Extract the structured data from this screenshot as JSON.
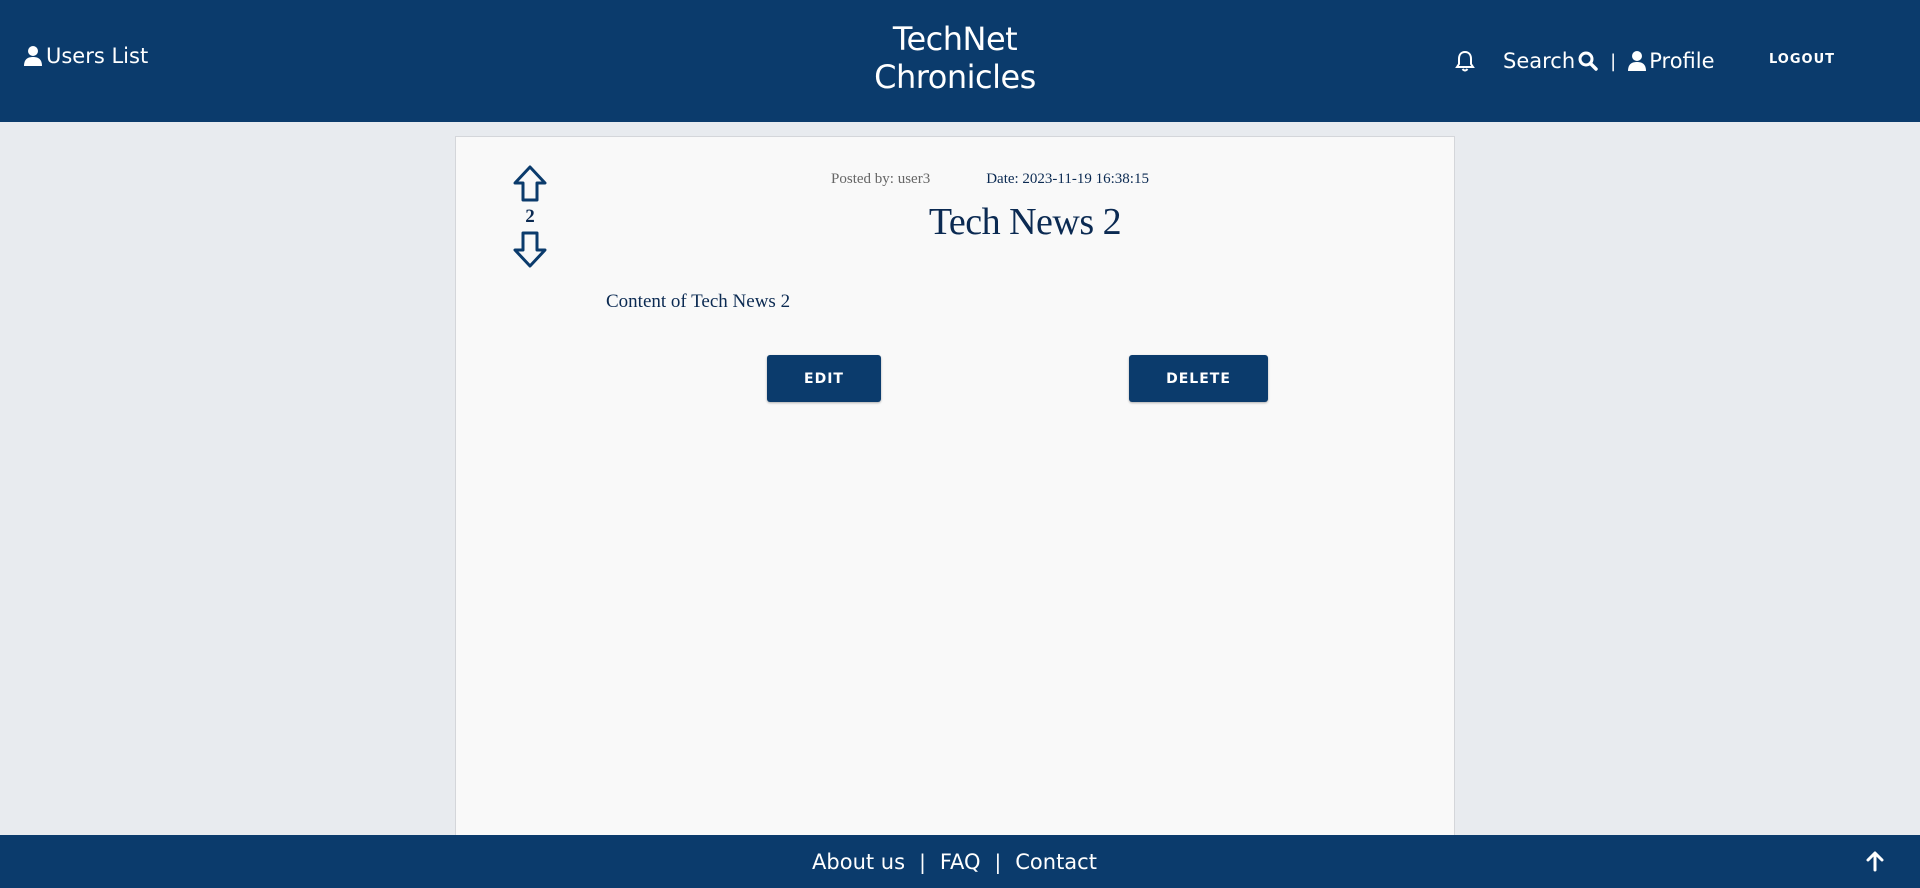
{
  "header": {
    "users_list_label": "Users List",
    "brand_line1": "TechNet",
    "brand_line2": "Chronicles",
    "search_label": "Search",
    "separator": "|",
    "profile_label": "Profile",
    "logout_label": "LOGOUT"
  },
  "post": {
    "votes": "2",
    "posted_by": "Posted by: user3",
    "date": "Date: 2023-11-19 16:38:15",
    "title": "Tech News 2",
    "content": "Content of Tech News 2",
    "edit_label": "EDIT",
    "delete_label": "DELETE"
  },
  "footer": {
    "links": [
      "About us",
      "FAQ",
      "Contact"
    ],
    "separator": "|"
  },
  "colors": {
    "primary": "#0b3b6c",
    "background": "#e8ebef",
    "card": "#f9f9f9",
    "text_dark": "#0b2a52"
  },
  "icons": [
    "user-icon",
    "bell-icon",
    "search-icon",
    "arrow-up-icon",
    "arrow-down-icon",
    "back-to-top-icon"
  ]
}
